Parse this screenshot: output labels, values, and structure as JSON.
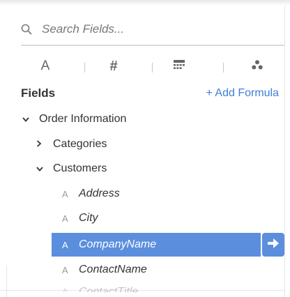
{
  "search": {
    "placeholder": "Search Fields..."
  },
  "type_tabs": [
    {
      "name": "text",
      "icon": "text-type-icon",
      "glyph": "A"
    },
    {
      "name": "number",
      "icon": "number-type-icon",
      "glyph": "#"
    },
    {
      "name": "date",
      "icon": "date-type-icon"
    },
    {
      "name": "geo",
      "icon": "geo-type-icon"
    }
  ],
  "fields_header": {
    "title": "Fields",
    "add_formula": "+ Add Formula"
  },
  "tree": {
    "order_information": "Order Information",
    "categories": "Categories",
    "customers": "Customers",
    "fields": [
      {
        "type_icon": "A",
        "label": "Address"
      },
      {
        "type_icon": "A",
        "label": "City"
      },
      {
        "type_icon": "A",
        "label": "CompanyName",
        "selected": true
      },
      {
        "type_icon": "A",
        "label": "ContactName"
      },
      {
        "type_icon": "A",
        "label": "ContactTitle"
      }
    ]
  },
  "colors": {
    "accent": "#5b8fdd",
    "link": "#3f7fd8",
    "text": "#333333",
    "muted": "#9a9a9a"
  }
}
